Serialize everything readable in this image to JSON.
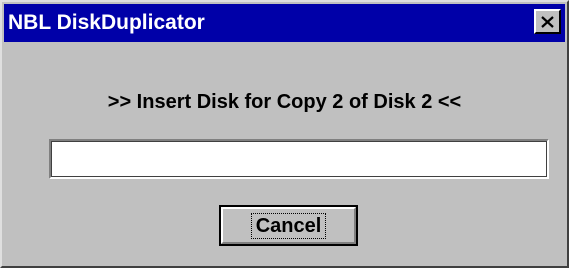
{
  "window": {
    "title": "NBL DiskDuplicator",
    "close_icon": "close-icon"
  },
  "dialog": {
    "prompt": ">> Insert Disk for Copy 2 of Disk 2 <<",
    "input_value": "",
    "cancel_label": "Cancel"
  },
  "colors": {
    "titlebar": "#0000a8",
    "face": "#c0c0c0",
    "title_text": "#ffffff"
  }
}
